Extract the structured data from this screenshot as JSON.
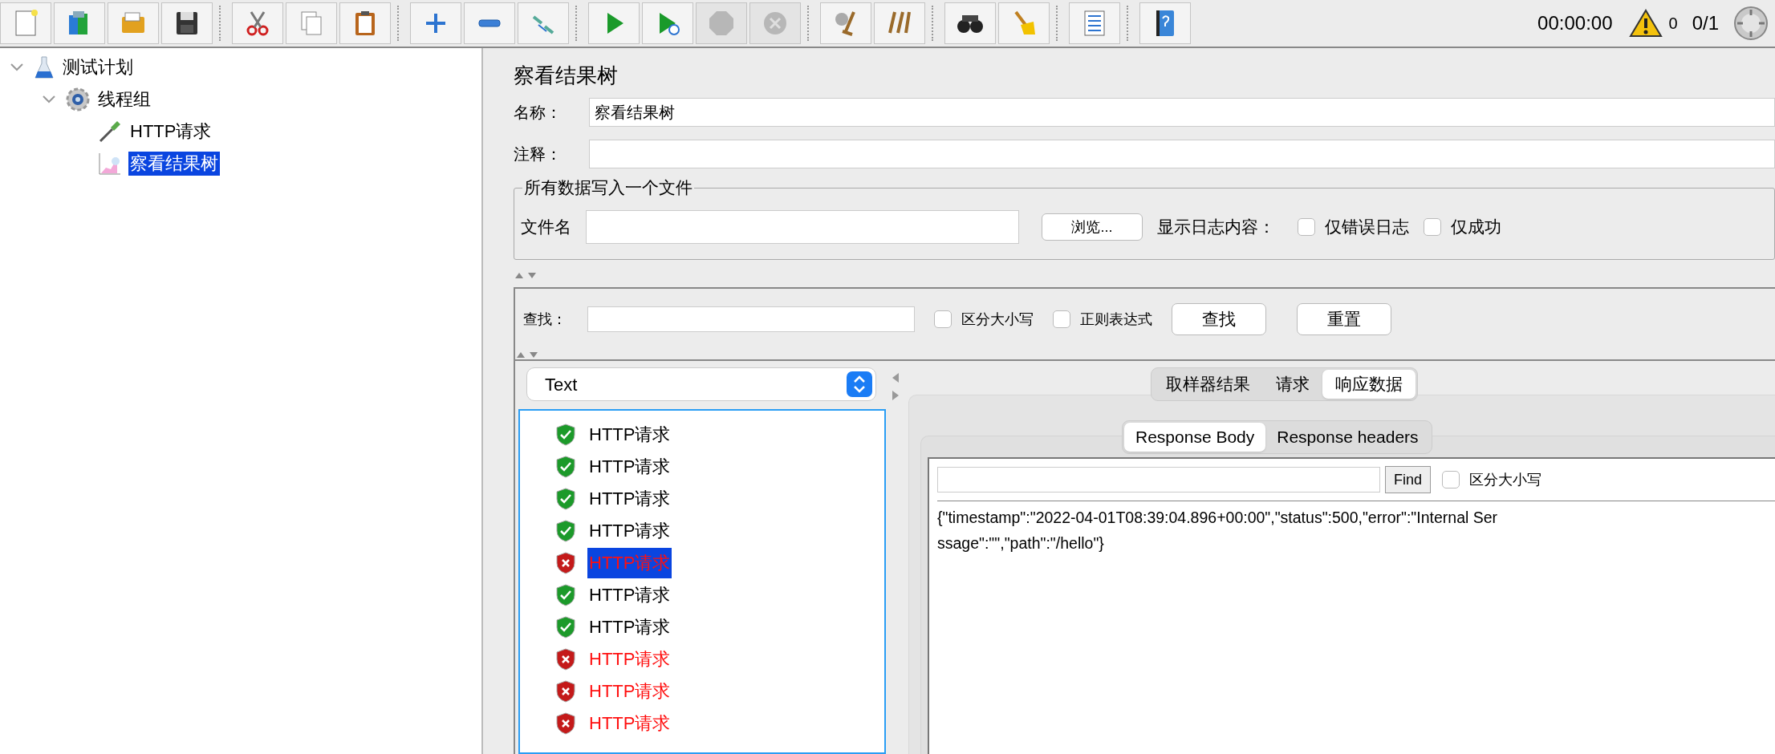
{
  "toolbar": [
    {
      "buttons": [
        {
          "kind": "new",
          "disabled": false
        },
        {
          "kind": "templates",
          "disabled": false
        },
        {
          "kind": "open",
          "disabled": false
        },
        {
          "kind": "save",
          "disabled": false
        }
      ]
    },
    {
      "buttons": [
        {
          "kind": "cut",
          "disabled": false
        },
        {
          "kind": "copy",
          "disabled": false
        },
        {
          "kind": "paste",
          "disabled": false
        }
      ]
    },
    {
      "buttons": [
        {
          "kind": "expand",
          "disabled": false
        },
        {
          "kind": "collapse",
          "disabled": false
        },
        {
          "kind": "toggle",
          "disabled": false
        }
      ]
    },
    {
      "buttons": [
        {
          "kind": "start",
          "disabled": false
        },
        {
          "kind": "start-no-pauses",
          "disabled": false
        },
        {
          "kind": "stop",
          "disabled": true
        },
        {
          "kind": "shutdown",
          "disabled": true
        }
      ]
    },
    {
      "buttons": [
        {
          "kind": "clear",
          "disabled": false
        },
        {
          "kind": "clear-all",
          "disabled": false
        }
      ]
    },
    {
      "buttons": [
        {
          "kind": "search",
          "disabled": false
        },
        {
          "kind": "reset-search",
          "disabled": false
        }
      ]
    },
    {
      "buttons": [
        {
          "kind": "function-helper",
          "disabled": false
        }
      ]
    },
    {
      "buttons": [
        {
          "kind": "help",
          "disabled": false
        }
      ]
    }
  ],
  "status": {
    "elapsed": "00:00:00",
    "warnings": "0",
    "threads": "0/1"
  },
  "tree": [
    {
      "label": "测试计划",
      "kind": "test-plan",
      "expanded": true,
      "selected": false,
      "children": [
        {
          "label": "线程组",
          "kind": "thread-group",
          "expanded": true,
          "selected": false,
          "children": [
            {
              "label": "HTTP请求",
              "kind": "sampler",
              "selected": false
            },
            {
              "label": "察看结果树",
              "kind": "listener",
              "selected": true
            }
          ]
        }
      ]
    }
  ],
  "panel": {
    "title": "察看结果树",
    "name_label": "名称：",
    "name_value": "察看结果树",
    "comment_label": "注释："
  },
  "file_group": {
    "legend": "所有数据写入一个文件",
    "filename_label": "文件名",
    "browse_button": "浏览...",
    "log_label": "显示日志内容：",
    "options": [
      {
        "label": "仅错误日志",
        "checked": false
      },
      {
        "label": "仅成功",
        "checked": false
      }
    ]
  },
  "search": {
    "label": "查找：",
    "options": [
      {
        "label": "区分大小写",
        "checked": false
      },
      {
        "label": "正则表达式",
        "checked": false
      }
    ],
    "buttons": [
      "查找",
      "重置"
    ]
  },
  "renderer": {
    "value": "Text"
  },
  "results": [
    {
      "label": "HTTP请求",
      "success": true,
      "selected": false
    },
    {
      "label": "HTTP请求",
      "success": true,
      "selected": false
    },
    {
      "label": "HTTP请求",
      "success": true,
      "selected": false
    },
    {
      "label": "HTTP请求",
      "success": true,
      "selected": false
    },
    {
      "label": "HTTP请求",
      "success": false,
      "selected": true
    },
    {
      "label": "HTTP请求",
      "success": true,
      "selected": false
    },
    {
      "label": "HTTP请求",
      "success": true,
      "selected": false
    },
    {
      "label": "HTTP请求",
      "success": false,
      "selected": false
    },
    {
      "label": "HTTP请求",
      "success": false,
      "selected": false
    },
    {
      "label": "HTTP请求",
      "success": false,
      "selected": false
    }
  ],
  "result_tabs": [
    {
      "label": "取样器结果",
      "selected": false
    },
    {
      "label": "请求",
      "selected": false
    },
    {
      "label": "响应数据",
      "selected": true
    }
  ],
  "response_tabs": [
    {
      "label": "Response Body",
      "selected": true
    },
    {
      "label": "Response headers",
      "selected": false
    }
  ],
  "response": {
    "find_button": "Find",
    "case_option": {
      "label": "区分大小写",
      "checked": false
    },
    "body_lines": [
      "{\"timestamp\":\"2022-04-01T08:39:04.896+00:00\",\"status\":500,\"error\":\"Internal Ser",
      "ssage\":\"\",\"path\":\"/hello\"}"
    ]
  }
}
